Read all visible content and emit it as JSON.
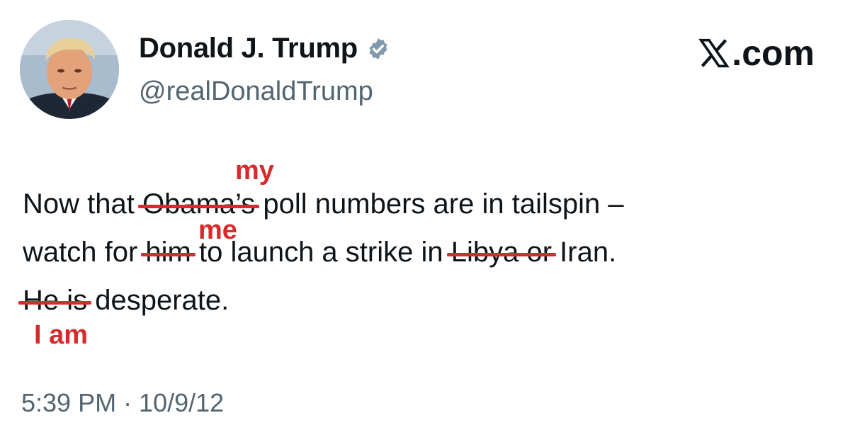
{
  "author": {
    "display_name": "Donald J. Trump",
    "handle": "@realDonaldTrump",
    "avatar_icon": "profile-photo",
    "verified_icon": "verified-badge-icon"
  },
  "site": {
    "label": ".com",
    "logo_icon": "x-logo-icon"
  },
  "tweet": {
    "line1": {
      "prefix": "Now that ",
      "struck": "Obama’s",
      "suffix": " poll numbers are in tailspin –"
    },
    "line2": {
      "prefix": "watch for ",
      "struck1": "him",
      "middle": " to launch a strike in ",
      "struck2": "Libya or",
      "suffix": " Iran."
    },
    "line3": {
      "struck": "He is",
      "suffix": " desperate."
    }
  },
  "annotations": {
    "over_obama": "my",
    "over_him": "me",
    "under_he_is": "I am",
    "color": "#d62b2b"
  },
  "timestamp": "5:39 PM · 10/9/12"
}
